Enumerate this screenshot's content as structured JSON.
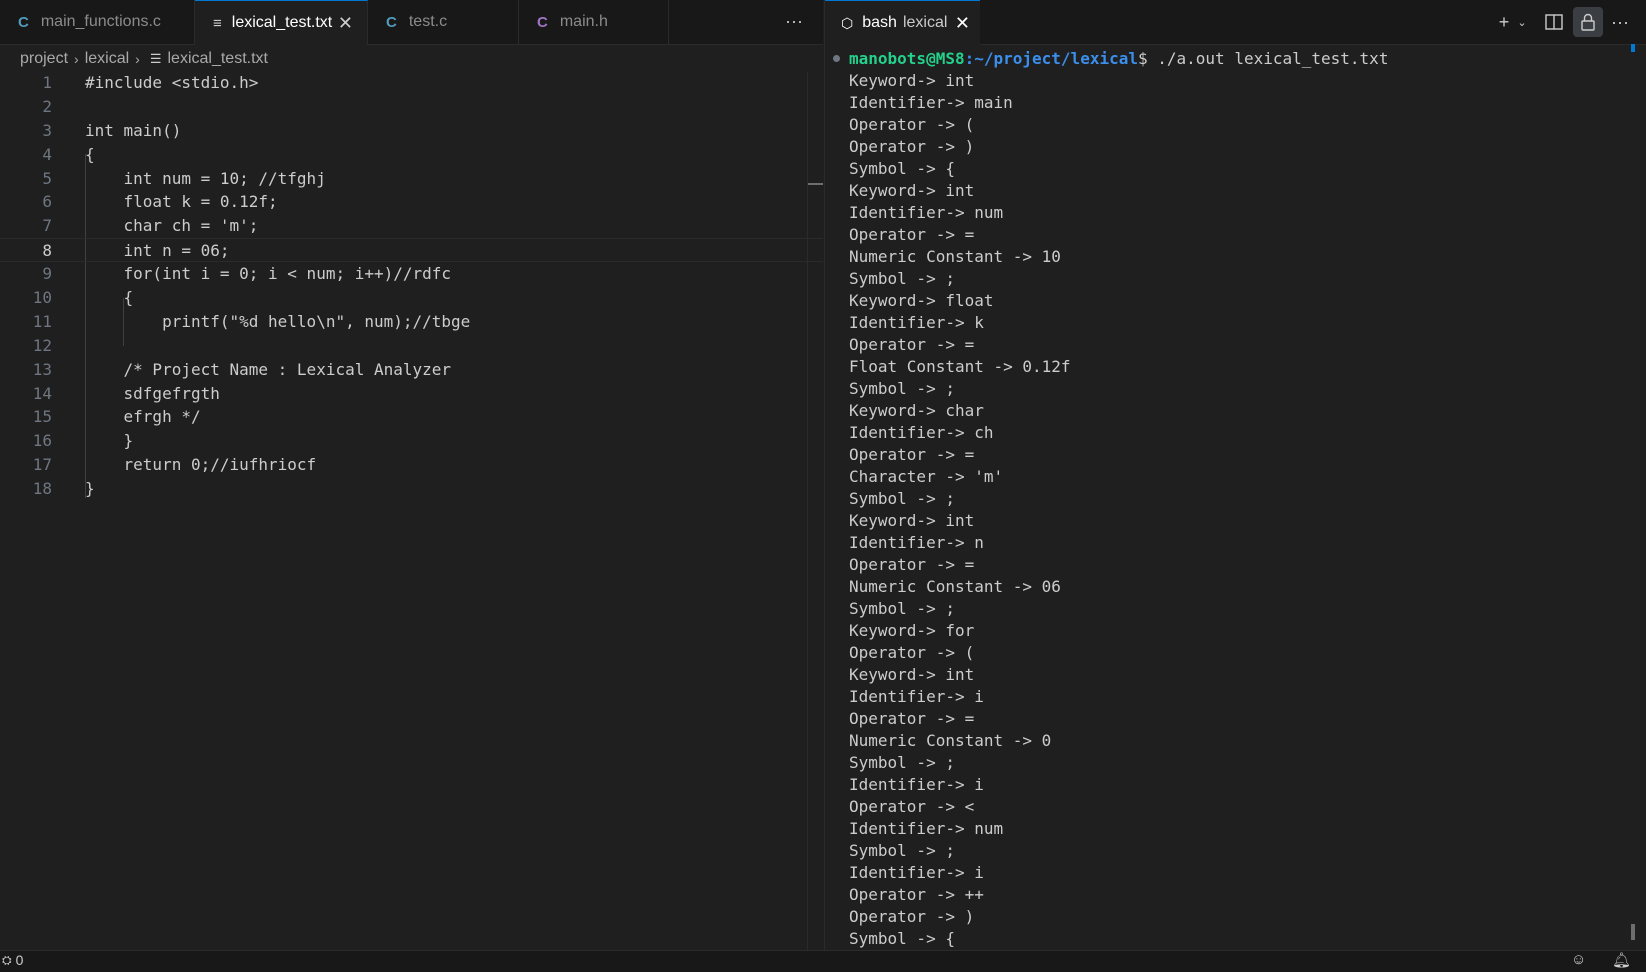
{
  "editor": {
    "tabs": [
      {
        "label": "main_functions.c",
        "icon": "C",
        "active": false
      },
      {
        "label": "lexical_test.txt",
        "icon": "≡",
        "active": true
      },
      {
        "label": "test.c",
        "icon": "C",
        "active": false
      },
      {
        "label": "main.h",
        "icon": "C",
        "active": false
      }
    ],
    "more_label": "···",
    "close_glyph": "✕",
    "breadcrumb": [
      "project",
      "lexical",
      "lexical_test.txt"
    ],
    "current_line": 8,
    "lines": [
      {
        "n": "1",
        "text": "#include <stdio.h>"
      },
      {
        "n": "2",
        "text": ""
      },
      {
        "n": "3",
        "text": "int main()"
      },
      {
        "n": "4",
        "text": "{"
      },
      {
        "n": "5",
        "text": "    int num = 10; //tfghj"
      },
      {
        "n": "6",
        "text": "    float k = 0.12f;"
      },
      {
        "n": "7",
        "text": "    char ch = 'm';"
      },
      {
        "n": "8",
        "text": "    int n = 06;"
      },
      {
        "n": "9",
        "text": "    for(int i = 0; i < num; i++)//rdfc"
      },
      {
        "n": "10",
        "text": "    {"
      },
      {
        "n": "11",
        "text": "        printf(\"%d hello\\n\", num);//tbge"
      },
      {
        "n": "12",
        "text": ""
      },
      {
        "n": "13",
        "text": "    /* Project Name : Lexical Analyzer"
      },
      {
        "n": "14",
        "text": "    sdfgefrgth"
      },
      {
        "n": "15",
        "text": "    efrgh */"
      },
      {
        "n": "16",
        "text": "    }"
      },
      {
        "n": "17",
        "text": "    return 0;//iufhriocf"
      },
      {
        "n": "18",
        "text": "}"
      }
    ]
  },
  "terminal": {
    "tab_label": "bash",
    "tab_sublabel": "lexical",
    "prompt": {
      "user_host": "manobots@MS8",
      "path": ":~/project/lexical",
      "symbol": "$",
      "command": " ./a.out lexical_test.txt"
    },
    "output": [
      "Keyword-> int",
      "Identifier-> main",
      "Operator -> (",
      "Operator -> )",
      "Symbol -> {",
      "Keyword-> int",
      "Identifier-> num",
      "Operator -> =",
      "Numeric Constant -> 10",
      "Symbol -> ;",
      "Keyword-> float",
      "Identifier-> k",
      "Operator -> =",
      "Float Constant -> 0.12f",
      "Symbol -> ;",
      "Keyword-> char",
      "Identifier-> ch",
      "Operator -> =",
      "Character -> 'm'",
      "Symbol -> ;",
      "Keyword-> int",
      "Identifier-> n",
      "Operator -> =",
      "Numeric Constant -> 06",
      "Symbol -> ;",
      "Keyword-> for",
      "Operator -> (",
      "Keyword-> int",
      "Identifier-> i",
      "Operator -> =",
      "Numeric Constant -> 0",
      "Symbol -> ;",
      "Identifier-> i",
      "Operator -> <",
      "Identifier-> num",
      "Symbol -> ;",
      "Identifier-> i",
      "Operator -> ++",
      "Operator -> )",
      "Symbol -> {"
    ]
  },
  "statusbar": {
    "ports_count": "0"
  },
  "colors": {
    "background": "#1f1f1f",
    "accent": "#0078d4",
    "prompt_user": "#23d18b",
    "prompt_path": "#3b8eea",
    "c_icon": "#519aba",
    "h_icon": "#a074c4"
  }
}
